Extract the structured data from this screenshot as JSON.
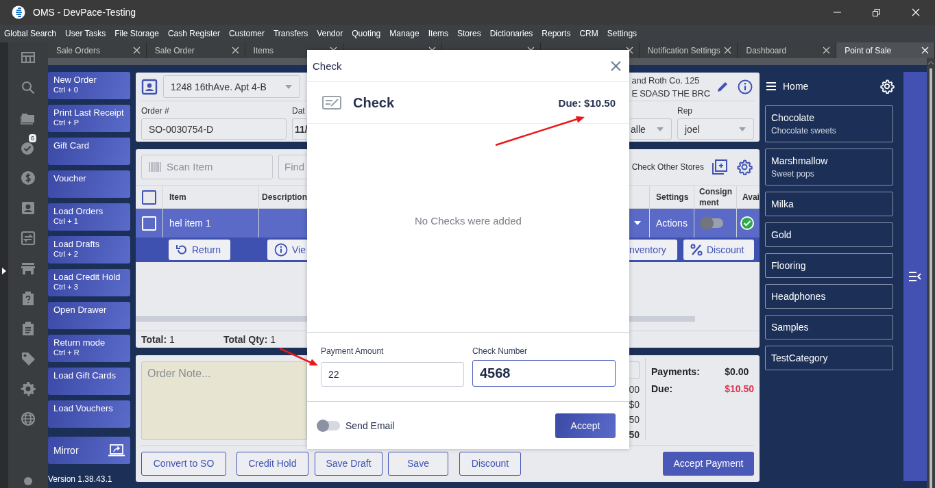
{
  "window": {
    "title": "OMS - DevPace-Testing"
  },
  "menu": [
    "Global Search",
    "User Tasks",
    "File Storage",
    "Cash Register",
    "Customer",
    "Transfers",
    "Vendor",
    "Quoting",
    "Manage",
    "Items",
    "Stores",
    "Dictionaries",
    "Reports",
    "CRM",
    "Settings"
  ],
  "tabs": [
    {
      "label": "Sale Orders",
      "selected": false
    },
    {
      "label": "Sale Order",
      "selected": false
    },
    {
      "label": "Items",
      "selected": false
    },
    {
      "selected": false
    },
    {
      "selected": false
    },
    {
      "selected": false
    },
    {
      "label": "Notification Settings",
      "selected": false
    },
    {
      "label": "Dashboard",
      "selected": false
    },
    {
      "label": "Point of Sale",
      "selected": true
    }
  ],
  "rail": {
    "badge": "6"
  },
  "actions": [
    {
      "label": "New Order",
      "shortcut": "Ctrl + 0"
    },
    {
      "label": "Print Last Receipt",
      "shortcut": "Ctrl + P"
    },
    {
      "label": "Gift Card"
    },
    {
      "label": "Voucher"
    },
    {
      "label": "Load Orders",
      "shortcut": "Ctrl + 1"
    },
    {
      "label": "Load Drafts",
      "shortcut": "Ctrl + 2"
    },
    {
      "label": "Load Credit Hold",
      "shortcut": "Ctrl + 3"
    },
    {
      "label": "Open Drawer"
    },
    {
      "label": "Return mode",
      "shortcut": "Ctrl + R"
    },
    {
      "label": "Load Gift Cards"
    },
    {
      "label": "Load Vouchers"
    }
  ],
  "mirror": "Mirror",
  "version": "Version 1.38.43.1",
  "order": {
    "address": "1248 16thAve. Apt 4-B",
    "order_label": "Order #",
    "order_number": "SO-0030754-D",
    "date_label": "Dat",
    "date": "11/",
    "customer_lines": [
      "and Roth Co. 125",
      "E SDASD THE BRC"
    ],
    "column_3_value": "alle",
    "rep_label": "Rep",
    "rep": "joel"
  },
  "items": {
    "scan_placeholder": "Scan Item",
    "find_placeholder": "Find",
    "check_stores": "Check Other Stores",
    "select_all_checked": false,
    "columns": [
      "Item",
      "Description",
      "Settings",
      "Consignment",
      "Avai"
    ],
    "rows": [
      {
        "item": "hel item 1",
        "checked": false,
        "selected": true,
        "settings": "Actions",
        "consignment": false,
        "available": true
      }
    ],
    "row_buttons": [
      {
        "kind": "return",
        "label": "Return"
      },
      {
        "kind": "view",
        "label": "Vie"
      },
      {
        "kind": "inventory",
        "label": "nventory"
      },
      {
        "kind": "discount",
        "label": "Discount"
      }
    ],
    "total": "**Total:** 1",
    "total_qty": "**Total Qty:** 1"
  },
  "summary": {
    "note_placeholder": "Order Note...",
    "amounts": [
      "00",
      "$0",
      "50",
      "50"
    ],
    "payments_label": "Payments:",
    "payments": "$0.00",
    "due_label": "Due:",
    "due": "$10.50",
    "buttons": [
      "Convert to SO",
      "Credit Hold",
      "Save Draft",
      "Save",
      "Discount"
    ],
    "accept_payment": "Accept Payment"
  },
  "categories": {
    "title": "Home",
    "items": [
      {
        "name": "Chocolate",
        "description": "Chocolate sweets"
      },
      {
        "name": "Marshmallow",
        "description": "Sweet pops"
      },
      {
        "name": "Milka"
      },
      {
        "name": "Gold"
      },
      {
        "name": "Flooring"
      },
      {
        "name": "Headphones"
      },
      {
        "name": "Samples"
      },
      {
        "name": "TestCategory"
      }
    ]
  },
  "dialog": {
    "title": "Check",
    "heading": "Check",
    "due": "Due: $10.50",
    "empty": "No Checks were added",
    "fields": [
      {
        "label": "Payment Amount",
        "value": "22",
        "focused": false
      },
      {
        "label": "Check Number",
        "value": "4568",
        "focused": true
      }
    ],
    "send_email": {
      "label": "Send Email",
      "on": false
    },
    "accept": "Accept"
  }
}
